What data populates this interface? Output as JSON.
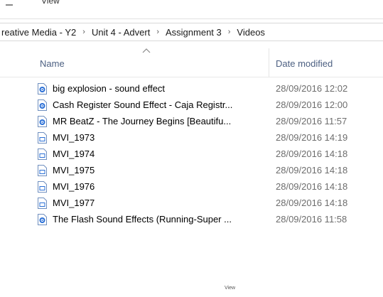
{
  "ribbon": {
    "tab_label": "View"
  },
  "breadcrumb": {
    "items": [
      "reative Media - Y2",
      "Unit 4 - Advert",
      "Assignment 3",
      "Videos"
    ],
    "separator": "›"
  },
  "columns": {
    "name_label": "Name",
    "date_label": "Date modified",
    "sort_indicator": "ascending"
  },
  "files": [
    {
      "name": "big explosion - sound effect",
      "date": "28/09/2016 12:02",
      "icon": "media-file-icon"
    },
    {
      "name": "Cash Register Sound Effect - Caja Registr...",
      "date": "28/09/2016 12:00",
      "icon": "media-file-icon"
    },
    {
      "name": "MR BeatZ - The Journey Begins [Beautifu...",
      "date": "28/09/2016 11:57",
      "icon": "media-file-icon"
    },
    {
      "name": "MVI_1973",
      "date": "28/09/2016 14:19",
      "icon": "video-file-icon"
    },
    {
      "name": "MVI_1974",
      "date": "28/09/2016 14:18",
      "icon": "video-file-icon"
    },
    {
      "name": "MVI_1975",
      "date": "28/09/2016 14:18",
      "icon": "video-file-icon"
    },
    {
      "name": "MVI_1976",
      "date": "28/09/2016 14:18",
      "icon": "video-file-icon"
    },
    {
      "name": "MVI_1977",
      "date": "28/09/2016 14:18",
      "icon": "video-file-icon"
    },
    {
      "name": "The Flash Sound Effects (Running-Super ...",
      "date": "28/09/2016 11:58",
      "icon": "media-file-icon"
    }
  ],
  "footer": {
    "view_label": "View"
  },
  "colors": {
    "header_text": "#4d6082",
    "date_text": "#6d6d6d",
    "icon_blue": "#2a6fd6"
  }
}
